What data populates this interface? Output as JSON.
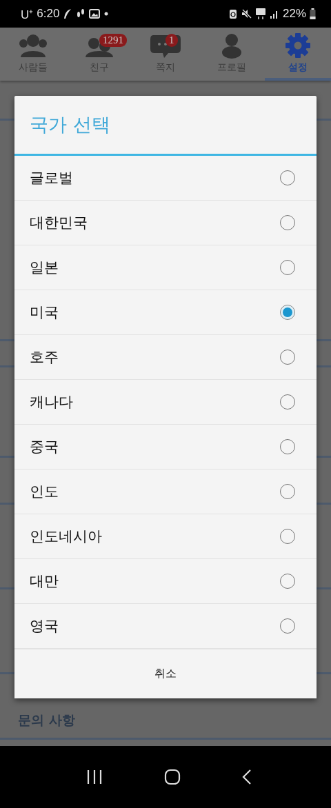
{
  "status_bar": {
    "carrier": "U⁺",
    "time": "6:20",
    "battery": "22%"
  },
  "tabs": [
    {
      "kind": "people",
      "label": "사람들",
      "selected": false
    },
    {
      "kind": "friends",
      "label": "친구",
      "badge": "1291",
      "selected": false
    },
    {
      "kind": "messages",
      "label": "쪽지",
      "badge": "1",
      "selected": false
    },
    {
      "kind": "profile",
      "label": "프로필",
      "selected": false
    },
    {
      "kind": "settings",
      "label": "설정",
      "selected": true
    }
  ],
  "background_section": "문의 사항",
  "dialog": {
    "title": "국가 선택",
    "options": [
      {
        "label": "글로벌",
        "selected": false
      },
      {
        "label": "대한민국",
        "selected": false
      },
      {
        "label": "일본",
        "selected": false
      },
      {
        "label": "미국",
        "selected": true
      },
      {
        "label": "호주",
        "selected": false
      },
      {
        "label": "캐나다",
        "selected": false
      },
      {
        "label": "중국",
        "selected": false
      },
      {
        "label": "인도",
        "selected": false
      },
      {
        "label": "인도네시아",
        "selected": false
      },
      {
        "label": "대만",
        "selected": false
      },
      {
        "label": "영국",
        "selected": false
      }
    ],
    "cancel": "취소"
  }
}
